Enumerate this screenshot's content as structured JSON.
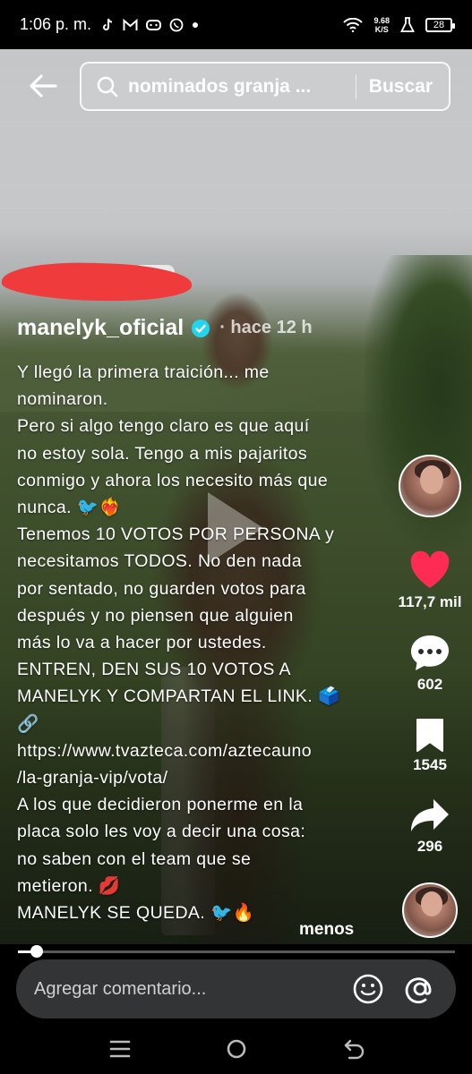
{
  "status_bar": {
    "time": "1:06 p. m.",
    "notification_icons": [
      "tiktok-icon",
      "gmail-icon",
      "gamepad-icon",
      "whatsapp-icon",
      "dot-icon"
    ],
    "network_speed_value": "9.68",
    "network_speed_unit": "K/S",
    "battery_level": "28"
  },
  "header": {
    "search_query": "nominados granja ...",
    "search_button_label": "Buscar"
  },
  "post": {
    "username": "manelyk_oficial",
    "verified": true,
    "time_ago": "· hace 12 h",
    "caption": "Y llegó la primera traición... me\nnominaron.\nPero si algo tengo claro es que aquí\nno estoy sola. Tengo a mis pajaritos\nconmigo y ahora los necesito más que\nnunca. 🐦❤️‍🔥\nTenemos 10 VOTOS POR PERSONA y\nnecesitamos TODOS. No den nada\npor sentado, no guarden votos para\ndespués y no piensen que alguien\nmás lo va a hacer por ustedes.\nENTREN, DEN SUS 10 VOTOS A\nMANELYK Y COMPARTAN EL LINK. 🗳️\n🔗\nhttps://www.tvazteca.com/aztecauno\n/la-granja-vip/vota/\nA los que decidieron ponerme en la\nplaca solo les voy a decir una cosa:\nno saben con el team que se\nmetieron. 💋\nMANELYK SE QUEDA. 🐦🔥",
    "collapse_label": "menos"
  },
  "actions": {
    "likes": "117,7 mil",
    "comments": "602",
    "saves": "1545",
    "shares": "296"
  },
  "playback": {
    "progress": 0.043
  },
  "comment_bar": {
    "placeholder": "Agregar comentario..."
  },
  "colors": {
    "like_red": "#fe2c55",
    "verified_blue": "#20d5ec",
    "comment_bar_bg": "#333435"
  }
}
